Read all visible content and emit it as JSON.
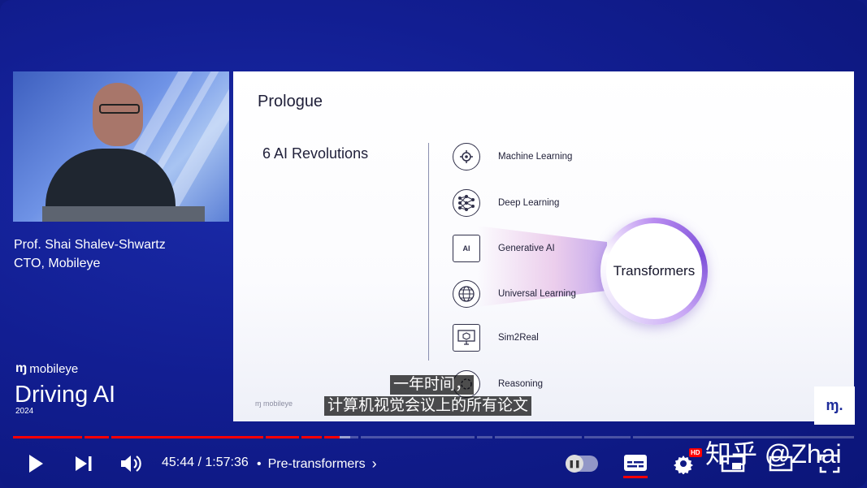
{
  "speaker": {
    "name": "Prof. Shai Shalev-Shwartz",
    "title": "CTO, Mobileye"
  },
  "brand": {
    "logo_mark": "ɱ",
    "logo_text": "mobileye",
    "event_title": "Driving AI",
    "event_year": "2024"
  },
  "slide": {
    "title": "Prologue",
    "subtitle": "6 AI Revolutions",
    "revolutions": [
      {
        "label": "Machine Learning",
        "icon": "gears-brain-icon"
      },
      {
        "label": "Deep Learning",
        "icon": "neural-network-icon"
      },
      {
        "label": "Generative AI",
        "icon": "ai-chip-icon",
        "icon_text": "AI"
      },
      {
        "label": "Universal Learning",
        "icon": "globe-icon"
      },
      {
        "label": "Sim2Real",
        "icon": "monitor-cube-icon"
      },
      {
        "label": "Reasoning",
        "icon": "reasoning-icon"
      }
    ],
    "highlight": "Transformers",
    "footer_logo": "ɱ mobileye",
    "corner_logo": "ɱ."
  },
  "subtitles": {
    "line1": "一年时间，",
    "line2": "计算机视觉会议上的所有论文"
  },
  "player": {
    "current_time": "45:44",
    "separator": " / ",
    "duration": "1:57:36",
    "chapter": "Pre-transformers",
    "progress_fraction": 0.3888,
    "buffered_fraction": 0.4012,
    "hd_badge": "HD",
    "autoplay_state": "paused"
  },
  "watermark": "知乎 @Zhai",
  "colors": {
    "background": "#0f1a85",
    "progress_played": "#ff0000",
    "accent_purple": "#7d4fd9"
  }
}
